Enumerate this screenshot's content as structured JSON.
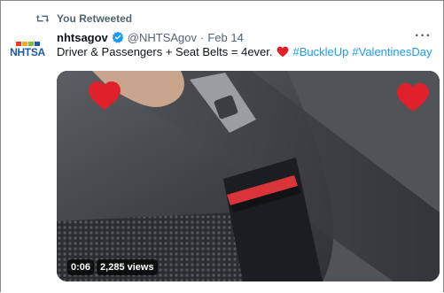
{
  "retweet_banner": {
    "label": "You Retweeted",
    "icon": "retweet-icon"
  },
  "account": {
    "avatar_text": "NHTSA",
    "name": "nhtsagov",
    "verified": true,
    "handle": "@NHTSAgov",
    "separator": "·",
    "date": "Feb 14"
  },
  "tweet": {
    "text_before": "Driver & Passengers + Seat Belts = 4ever.",
    "hashtag_1": "#BuckleUp",
    "hashtag_2": "#ValentinesDay"
  },
  "more_menu": {
    "label": "···",
    "icon": "more-horizontal-icon"
  },
  "media": {
    "type": "video",
    "duration": "0:06",
    "views": "2,285 views",
    "description_icon_left": "heart-icon",
    "description_icon_right": "heart-icon"
  },
  "colors": {
    "link": "#1d9bf0",
    "verified": "#1d9bf0",
    "heart": "#e0202a",
    "muted": "#536471"
  }
}
